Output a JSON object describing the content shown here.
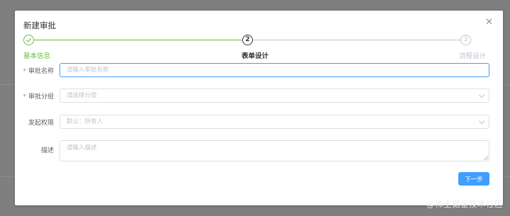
{
  "dialog": {
    "title": "新建审批",
    "close_icon": "close-icon"
  },
  "steps": [
    {
      "number": "1",
      "title": "基本信息",
      "status": "finished",
      "icon": "check-icon",
      "color": "#67c23a"
    },
    {
      "number": "2",
      "title": "表单设计",
      "status": "process",
      "color": "#303133"
    },
    {
      "number": "3",
      "title": "流程设计",
      "status": "wait",
      "color": "#c0c4cc"
    }
  ],
  "form": {
    "name": {
      "label": "审批名称",
      "required_mark": "*",
      "value": "",
      "placeholder": "请输入审批名称"
    },
    "group": {
      "label": "审批分组",
      "required_mark": "*",
      "value": "",
      "placeholder": "请选择分组"
    },
    "scope": {
      "label": "发起权限",
      "value": "",
      "placeholder": "默认：所有人"
    },
    "description": {
      "label": "描述",
      "value": "",
      "placeholder": "请输入描述"
    }
  },
  "actions": {
    "next_label": "下一步"
  },
  "watermark": "@稀土掘金技术社区",
  "colors": {
    "primary": "#409eff",
    "success": "#67c23a",
    "danger": "#f56c6c",
    "overlay": "#7f7f7f"
  }
}
